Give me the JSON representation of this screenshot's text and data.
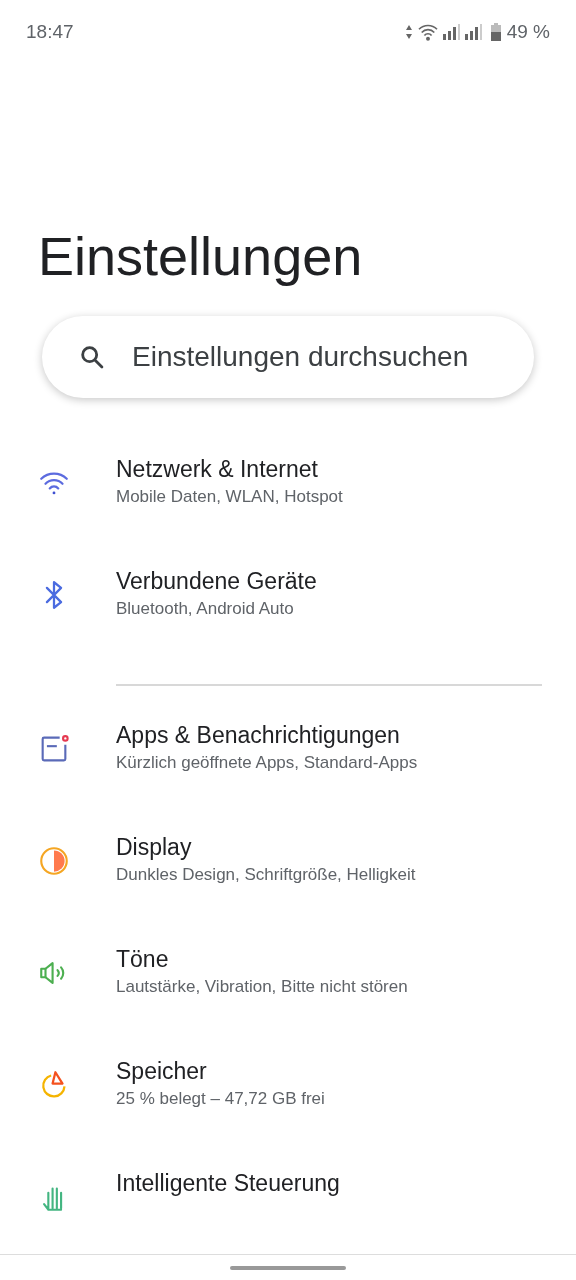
{
  "status_bar": {
    "time": "18:47",
    "battery": "49 %"
  },
  "title": "Einstellungen",
  "search": {
    "placeholder": "Einstellungen durchsuchen"
  },
  "groups": [
    {
      "items": [
        {
          "title": "Netzwerk & Internet",
          "subtitle": "Mobile Daten, WLAN, Hotspot"
        },
        {
          "title": "Verbundene Geräte",
          "subtitle": "Bluetooth, Android Auto"
        }
      ]
    },
    {
      "items": [
        {
          "title": "Apps & Benachrichtigungen",
          "subtitle": "Kürzlich geöffnete Apps, Standard-Apps"
        },
        {
          "title": "Display",
          "subtitle": "Dunkles Design, Schriftgröße, Helligkeit"
        },
        {
          "title": "Töne",
          "subtitle": "Lautstärke, Vibration, Bitte nicht stören"
        },
        {
          "title": "Speicher",
          "subtitle": "25 % belegt – 47,72 GB frei"
        },
        {
          "title": "Intelligente Steuerung"
        }
      ]
    }
  ]
}
